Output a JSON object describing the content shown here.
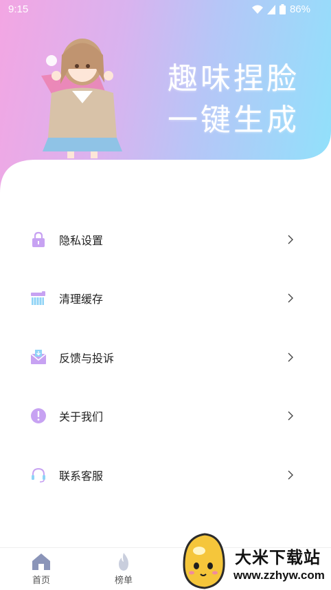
{
  "status_bar": {
    "time": "9:15",
    "battery": "86%"
  },
  "banner": {
    "line1": "趣味捏脸",
    "line2": "一键生成"
  },
  "menu": {
    "items": [
      {
        "label": "隐私设置",
        "icon": "lock-icon"
      },
      {
        "label": "清理缓存",
        "icon": "broom-icon"
      },
      {
        "label": "反馈与投诉",
        "icon": "mail-icon"
      },
      {
        "label": "关于我们",
        "icon": "info-icon"
      },
      {
        "label": "联系客服",
        "icon": "headset-icon"
      }
    ]
  },
  "tabbar": {
    "tabs": [
      {
        "label": "首页",
        "icon": "home-icon"
      },
      {
        "label": "榜单",
        "icon": "flame-icon"
      }
    ]
  },
  "watermark": {
    "name": "大米下载站",
    "url": "www.zzhyw.com"
  },
  "colors": {
    "gradient_start": "#f3a6e3",
    "gradient_end": "#8fe2fb",
    "icon_purple": "#c7a2f2",
    "icon_blue": "#8fd3f6"
  }
}
